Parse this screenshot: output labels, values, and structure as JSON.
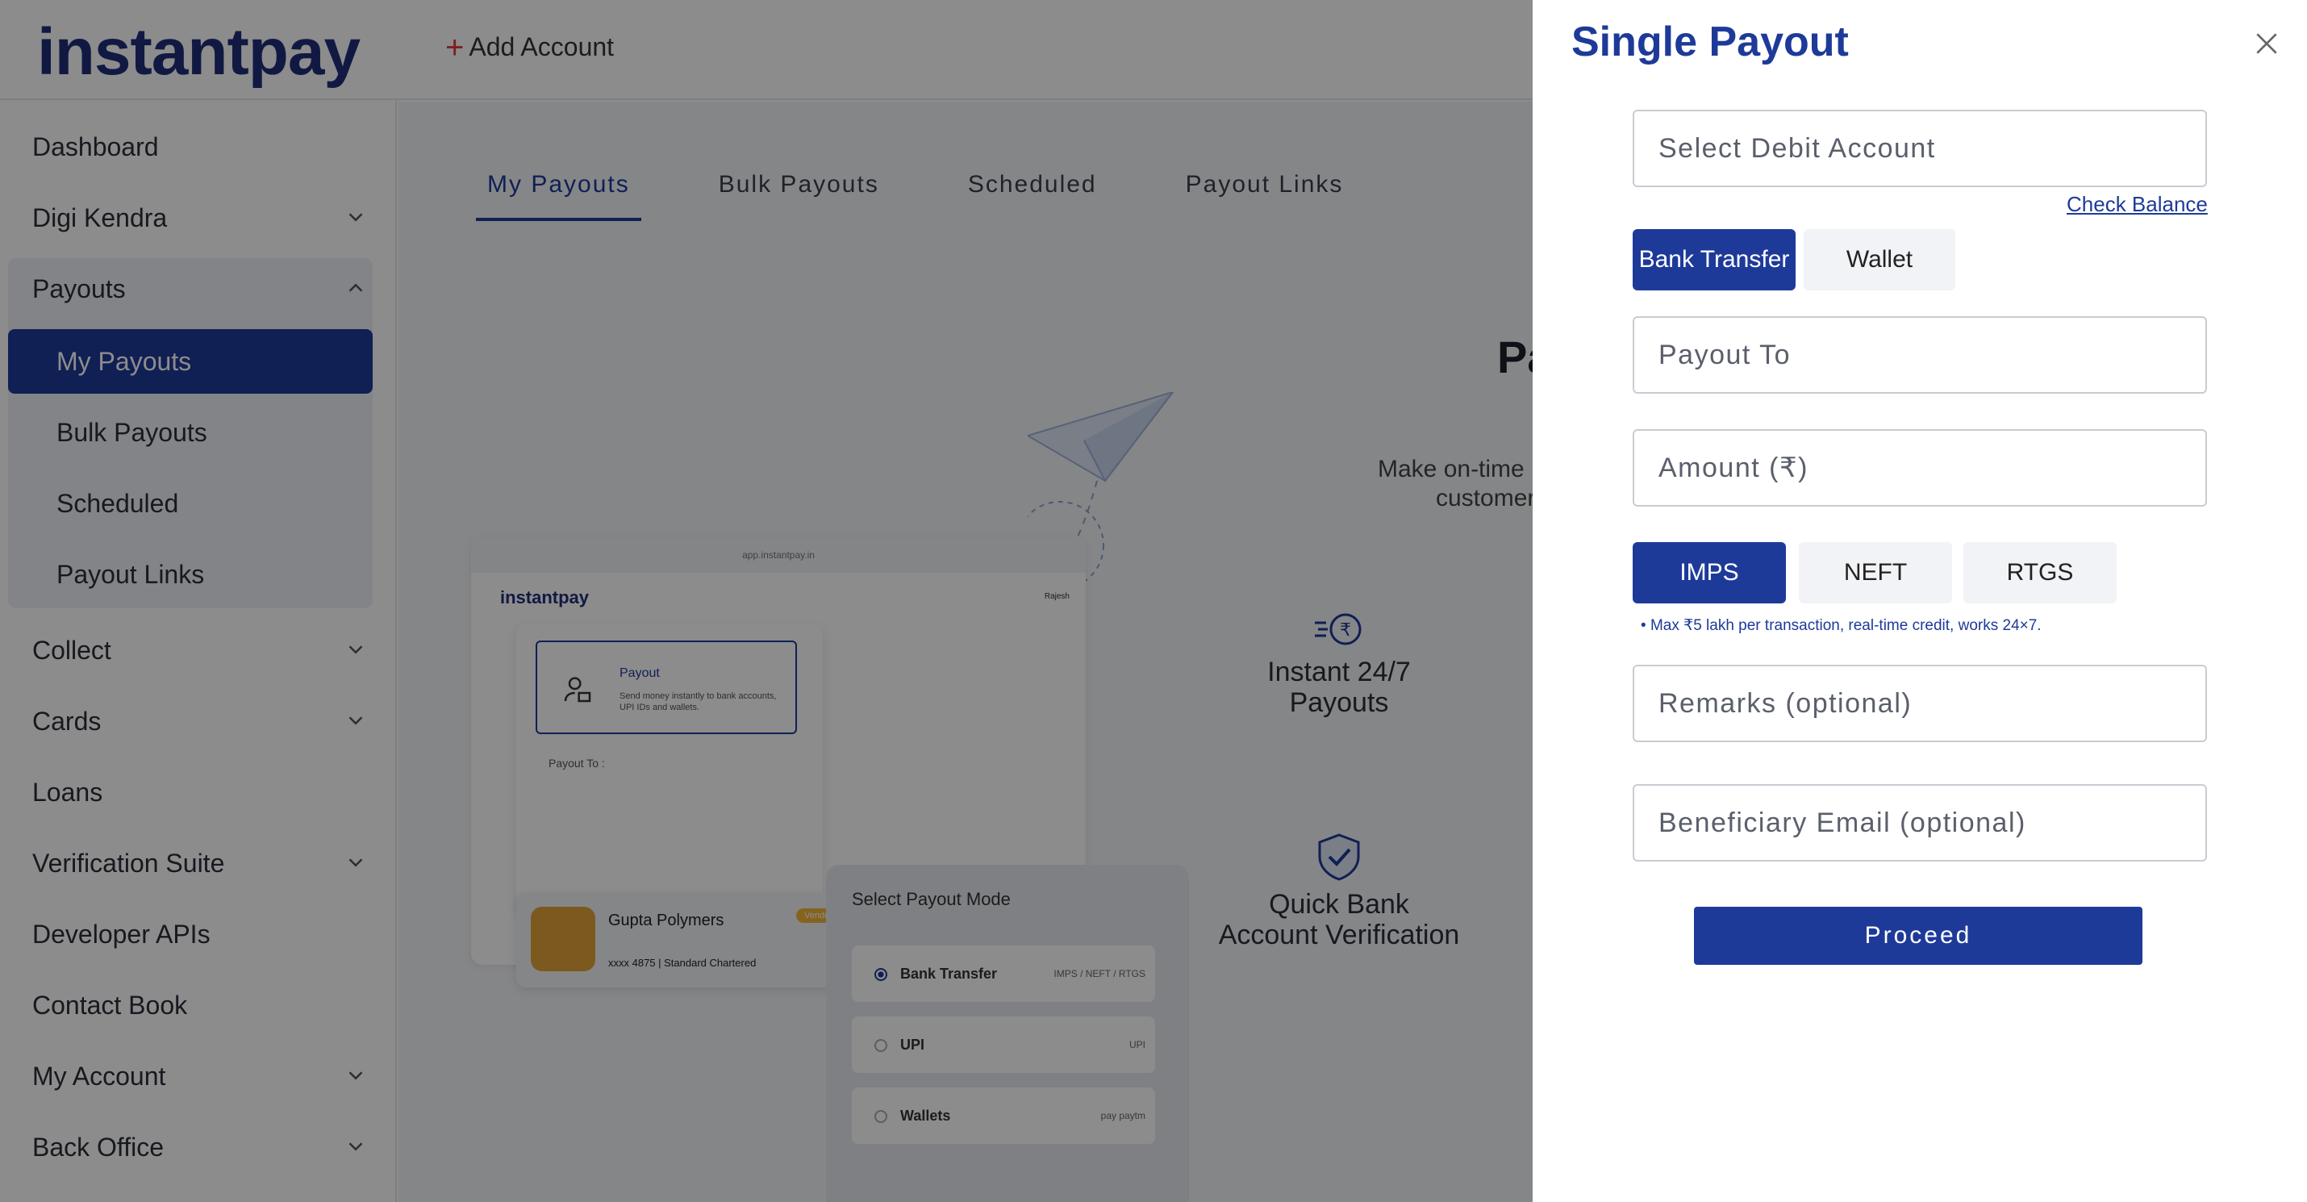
{
  "app": {
    "logo": "instantpay",
    "add_account": "Add Account"
  },
  "sidebar": {
    "items": [
      {
        "label": "Dashboard"
      },
      {
        "label": "Digi Kendra"
      },
      {
        "label": "Payouts"
      },
      {
        "label": "Collect"
      },
      {
        "label": "Cards"
      },
      {
        "label": "Loans"
      },
      {
        "label": "Verification Suite"
      },
      {
        "label": "Developer APIs"
      },
      {
        "label": "Contact Book"
      },
      {
        "label": "My Account"
      },
      {
        "label": "Back Office"
      }
    ],
    "payouts_sub": [
      {
        "label": "My Payouts",
        "active": true
      },
      {
        "label": "Bulk Payouts"
      },
      {
        "label": "Scheduled"
      },
      {
        "label": "Payout Links"
      }
    ]
  },
  "main": {
    "tabs": [
      {
        "label": "My Payouts",
        "active": true
      },
      {
        "label": "Bulk Payouts"
      },
      {
        "label": "Scheduled"
      },
      {
        "label": "Payout Links"
      }
    ],
    "hero_title_fragment": "Pa",
    "hero_sub_line1": "Make on-time",
    "hero_sub_line2": "customer",
    "features": [
      {
        "line1": "Instant 24/7",
        "line2": "Payouts",
        "icon": "rupee-speed-icon"
      },
      {
        "line1": "Quick Bank",
        "line2": "Account Verification",
        "icon": "shield-check-icon"
      }
    ],
    "illustration": {
      "url": "app.instantpay.in",
      "logo": "instantpay",
      "user": "Rajesh",
      "payout_title": "Payout",
      "payout_desc": "Send money instantly to bank accounts, UPI IDs and wallets.",
      "payout_to": "Payout To :",
      "vendor_name": "Gupta Polymers",
      "vendor_badge": "Vendor",
      "vendor_account": "xxxx 4875 | Standard Chartered",
      "mode_title": "Select Payout Mode",
      "modes": [
        {
          "label": "Bank Transfer",
          "right": "IMPS / NEFT / RTGS",
          "selected": true
        },
        {
          "label": "UPI",
          "right": "UPI"
        },
        {
          "label": "Wallets",
          "right": "pay paytm"
        }
      ]
    }
  },
  "drawer": {
    "title": "Single Payout",
    "debit_account_placeholder": "Select Debit Account",
    "check_balance": "Check Balance",
    "method_tabs": [
      {
        "label": "Bank Transfer",
        "active": true
      },
      {
        "label": "Wallet",
        "active": false
      }
    ],
    "payout_to_placeholder": "Payout To",
    "amount_placeholder": "Amount (₹)",
    "modes": [
      {
        "label": "IMPS",
        "active": true
      },
      {
        "label": "NEFT",
        "active": false
      },
      {
        "label": "RTGS",
        "active": false
      }
    ],
    "mode_hint": "Max ₹5 lakh per transaction, real-time credit, works 24×7.",
    "remarks_placeholder": "Remarks (optional)",
    "email_placeholder": "Beneficiary Email (optional)",
    "proceed_label": "Proceed"
  },
  "colors": {
    "brand": "#1e3a99",
    "overlay": "rgba(0,0,0,0.45)"
  }
}
